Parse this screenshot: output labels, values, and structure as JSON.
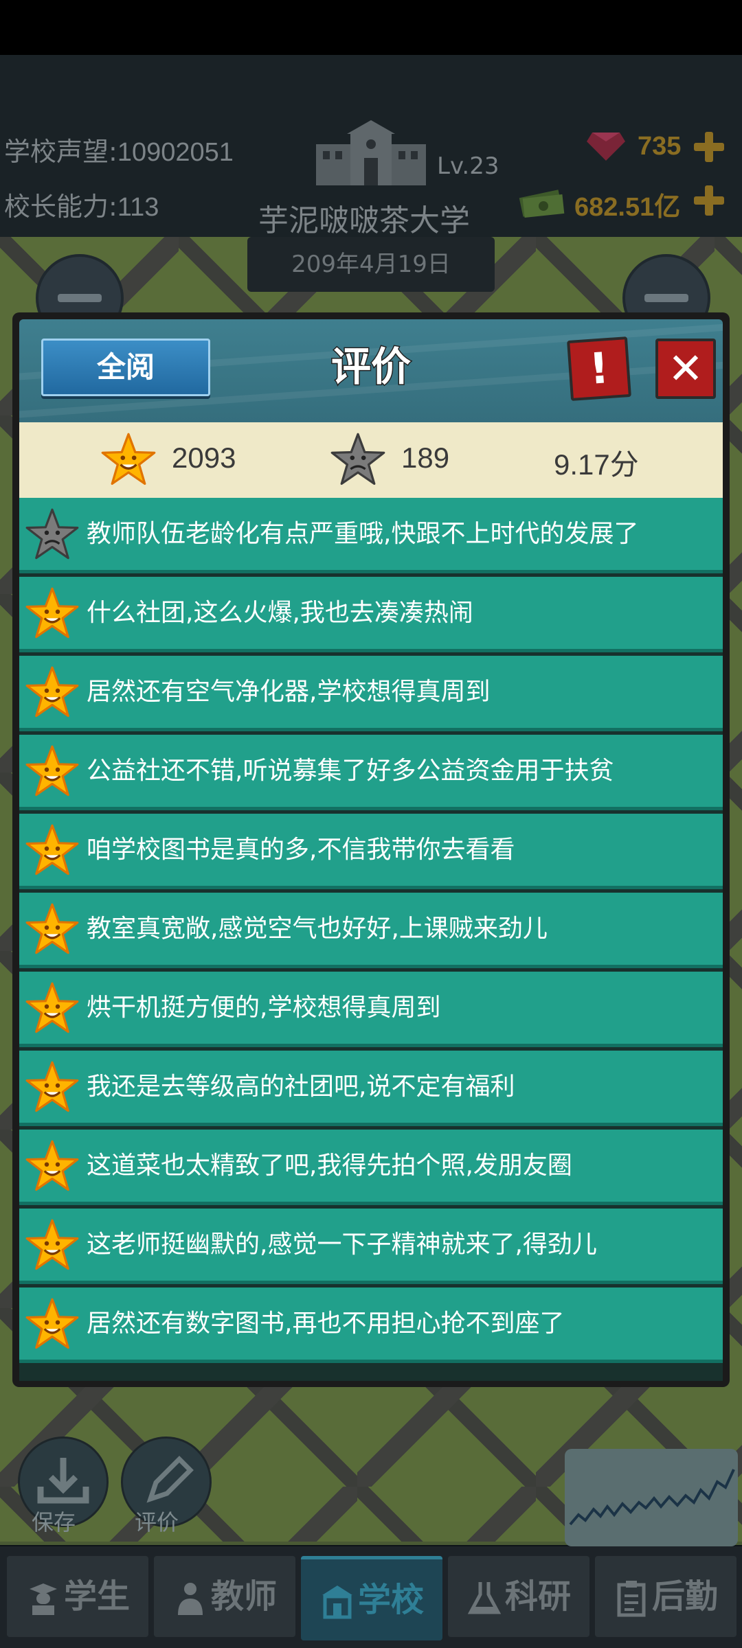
{
  "header": {
    "reputation_label": "学校声望:",
    "reputation_value": "10902051",
    "ability_label": "校长能力:",
    "ability_value": "113",
    "level": "Lv.23",
    "school_name": "芋泥啵啵茶大学",
    "date": "209年4月19日",
    "gems": "735",
    "money": "682.51亿"
  },
  "dialog": {
    "read_all_label": "全阅",
    "title": "评价",
    "alert_label": "!",
    "close_label": "✕",
    "positive_count": "2093",
    "negative_count": "189",
    "score": "9.17分",
    "reviews": [
      {
        "sentiment": "negative",
        "text": "教师队伍老龄化有点严重哦,快跟不上时代的发展了"
      },
      {
        "sentiment": "positive",
        "text": "什么社团,这么火爆,我也去凑凑热闹"
      },
      {
        "sentiment": "positive",
        "text": "居然还有空气净化器,学校想得真周到"
      },
      {
        "sentiment": "positive",
        "text": "公益社还不错,听说募集了好多公益资金用于扶贫"
      },
      {
        "sentiment": "positive",
        "text": "咱学校图书是真的多,不信我带你去看看"
      },
      {
        "sentiment": "positive",
        "text": "教室真宽敞,感觉空气也好好,上课贼来劲儿"
      },
      {
        "sentiment": "positive",
        "text": "烘干机挺方便的,学校想得真周到"
      },
      {
        "sentiment": "positive",
        "text": "我还是去等级高的社团吧,说不定有福利"
      },
      {
        "sentiment": "positive",
        "text": "这道菜也太精致了吧,我得先拍个照,发朋友圈"
      },
      {
        "sentiment": "positive",
        "text": "这老师挺幽默的,感觉一下子精神就来了,得劲儿"
      },
      {
        "sentiment": "positive",
        "text": "居然还有数字图书,再也不用担心抢不到座了"
      }
    ]
  },
  "bottom": {
    "save_label": "保存",
    "review_label": "评价"
  },
  "tabs": [
    {
      "label": "学生",
      "icon": "student-icon"
    },
    {
      "label": "教师",
      "icon": "teacher-icon"
    },
    {
      "label": "学校",
      "icon": "school-icon",
      "active": true
    },
    {
      "label": "科研",
      "icon": "flask-icon"
    },
    {
      "label": "后勤",
      "icon": "clipboard-icon"
    }
  ],
  "colors": {
    "positive_star": "#ffb400",
    "negative_star": "#6d6d6d",
    "row_bg": "#21a08b",
    "close_red": "#b01d1d"
  }
}
